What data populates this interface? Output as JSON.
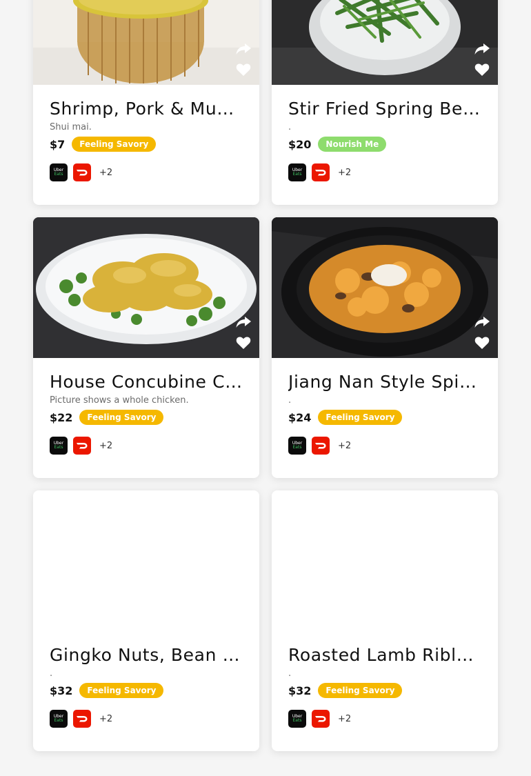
{
  "colors": {
    "feeling_savory": "#f5b800",
    "nourish_me": "#8edc6d",
    "uber_eats_bg": "#0b0b0b",
    "doordash_bg": "#eb1700"
  },
  "icons": {
    "share": "share-arrow-icon",
    "favorite": "heart-icon",
    "uber_eats": "uber-eats-icon",
    "doordash": "doordash-icon"
  },
  "delivery_icon_text": {
    "uber_line1": "Uber",
    "uber_line2": "Eats"
  },
  "dishes": [
    {
      "title": "Shrimp, Pork & Mus…",
      "desc": "Shui mai.",
      "price": "$7",
      "tag": "Feeling Savory",
      "tag_color": "#f5b800",
      "more": "+2"
    },
    {
      "title": "Stir Fried Spring Be…",
      "desc": ".",
      "price": "$20",
      "tag": "Nourish Me",
      "tag_color": "#8edc6d",
      "more": "+2"
    },
    {
      "title": "House Concubine C…",
      "desc": "Picture shows a whole chicken.",
      "price": "$22",
      "tag": "Feeling Savory",
      "tag_color": "#f5b800",
      "more": "+2"
    },
    {
      "title": "Jiang Nan Style Spic…",
      "desc": ".",
      "price": "$24",
      "tag": "Feeling Savory",
      "tag_color": "#f5b800",
      "more": "+2"
    },
    {
      "title": "Gingko Nuts, Bean …",
      "desc": ".",
      "price": "$32",
      "tag": "Feeling Savory",
      "tag_color": "#f5b800",
      "more": "+2"
    },
    {
      "title": "Roasted Lamb Rible…",
      "desc": ".",
      "price": "$32",
      "tag": "Feeling Savory",
      "tag_color": "#f5b800",
      "more": "+2"
    }
  ]
}
